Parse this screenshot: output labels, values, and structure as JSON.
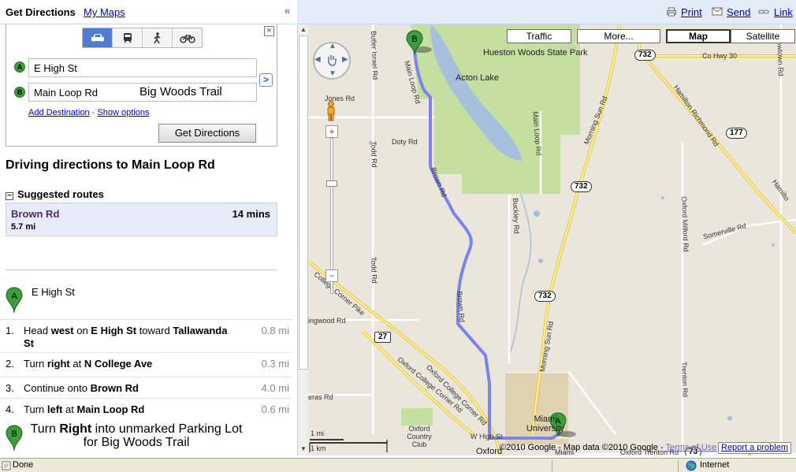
{
  "tabs": {
    "directions": "Get Directions",
    "my_maps": "My Maps",
    "collapse": "«"
  },
  "toolbar": {
    "print": "Print",
    "send": "Send",
    "link": "Link"
  },
  "form": {
    "modes": [
      "car-icon",
      "transit-icon",
      "walk-icon",
      "bike-icon"
    ],
    "active_mode": "car",
    "marker_a": "A",
    "marker_b": "B",
    "origin_value": "E High St",
    "destination_value": "Main Loop Rd",
    "destination_extra": "Big Woods Trail",
    "add_destination": "Add Destination",
    "separator": " - ",
    "show_options": "Show options",
    "submit_label": "Get Directions",
    "close": "×",
    "swap": ">"
  },
  "directions": {
    "heading": "Driving directions to Main Loop Rd",
    "suggested_routes_label": "Suggested routes",
    "route": {
      "name": "Brown Rd",
      "time": "14 mins",
      "distance": "5.7 mi"
    },
    "start_marker": "A",
    "start_label": "E High St",
    "steps": [
      {
        "num": "1.",
        "pre": "Head ",
        "bold1": "west",
        "mid": " on ",
        "bold2": "E High St",
        "mid2": " toward ",
        "bold3": "Tallawanda St",
        "distance": "0.8 mi"
      },
      {
        "num": "2.",
        "pre": "Turn ",
        "bold1": "right",
        "mid": " at ",
        "bold2": "N College Ave",
        "mid2": "",
        "bold3": "",
        "distance": "0.3 mi"
      },
      {
        "num": "3.",
        "pre": "Continue onto ",
        "bold1": "Brown Rd",
        "mid": "",
        "bold2": "",
        "mid2": "",
        "bold3": "",
        "distance": "4.0 mi"
      },
      {
        "num": "4.",
        "pre": "Turn ",
        "bold1": "left",
        "mid": " at ",
        "bold2": "Main Loop Rd",
        "mid2": "",
        "bold3": "",
        "distance": "0.6 mi"
      }
    ],
    "end_marker": "B",
    "end_pre": "Turn ",
    "end_bold": "Right",
    "end_post": " into unmarked Parking Lot for Big Woods Trail"
  },
  "map": {
    "buttons": {
      "traffic": "Traffic",
      "more": "More...",
      "map": "Map",
      "satellite": "Satellite"
    },
    "active_view": "Map",
    "shields": [
      "732",
      "177",
      "732",
      "732",
      "27",
      "73"
    ],
    "labels": {
      "park": "Hueston Woods State Park",
      "lake": "Acton Lake",
      "co_hwy": "Co Hwy 30",
      "hamilton_richmond": "Hamilton Richmond Rd",
      "hamilton": "Hamilto",
      "morning_sun": "Morning Sun Rd",
      "morning_sun_2": "Morning Sun Rd",
      "main_loop": "Main Loop Rd",
      "main_loop_2": "Main Loop Rd",
      "butler_israel": "Butler Israel Rd",
      "jones": "Jones Rd",
      "doty": "Doty Rd",
      "todd": "Todd Rd",
      "todd_2": "Todd Rd",
      "brown": "Brown Rd",
      "brown_2": "Brown Rd",
      "buckley": "Buckley Rd",
      "oxford_milford": "Oxford Milford Rd",
      "somerville": "Somerville Rd",
      "trenton": "Trenton Rd",
      "college_corner": "College Corner Pike",
      "oxford_college_corner": "Oxford College Corner Rd",
      "oxford_college_corner_2": "Oxford College Corner Rd",
      "ingwood": "ingwood Rd",
      "harrow": "arrowtown Rd",
      "veras": "eras Rd",
      "oxford_country_club": "Oxford Country Club",
      "miami_university": "Miami University",
      "high_st": "W High St",
      "oxford": "Oxford",
      "miami": "Miami",
      "trenton_oxford": "Oxford Trenton Rd"
    },
    "markers": {
      "a": "A",
      "b": "B"
    },
    "pan_icon": "hand-icon",
    "zoom_in": "+",
    "zoom_out": "−",
    "scale_mi": "1 mi",
    "scale_km": "1 km",
    "copyright": "©2010 Google - Map data ©2010 Google -",
    "terms": "Terms of Use",
    "report": "Report a problem"
  },
  "status": {
    "done": "Done",
    "zone": "Internet"
  },
  "colors": {
    "route": "#7b83ec",
    "park": "#c4dfa0",
    "water": "#a6bfdd",
    "highway": "#f5e469",
    "marker": "#3c9d3c"
  }
}
